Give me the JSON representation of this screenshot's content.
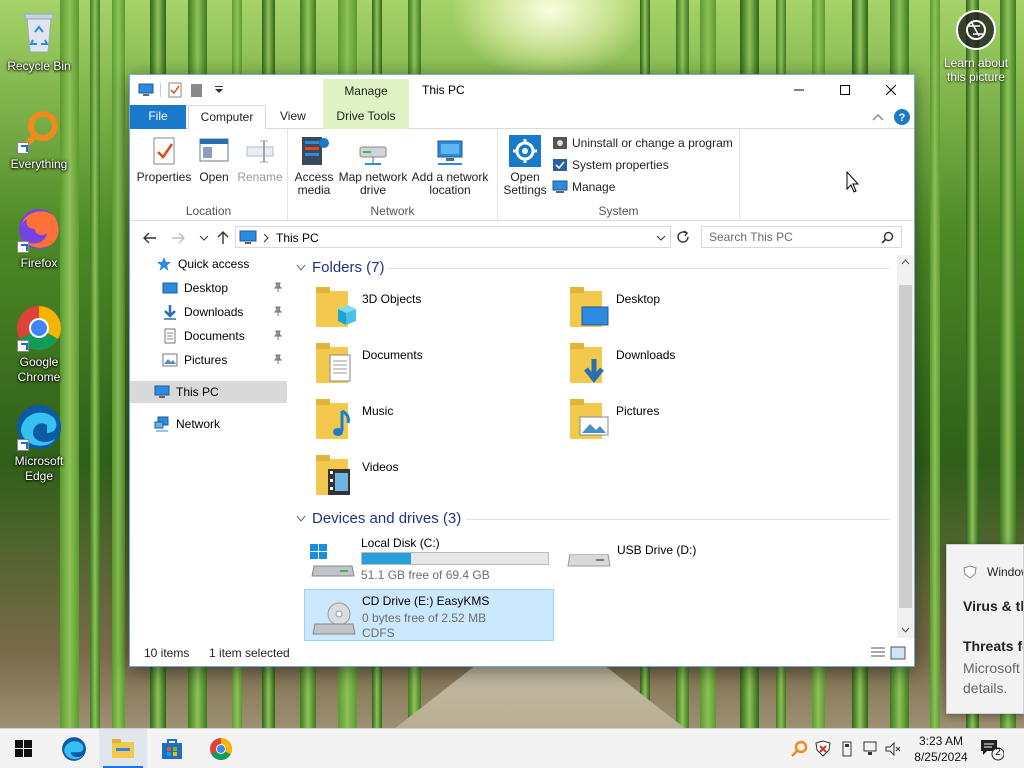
{
  "desktop": {
    "icons": [
      {
        "label": "Recycle Bin"
      },
      {
        "label": "Everything"
      },
      {
        "label": "Firefox"
      },
      {
        "label": "Google Chrome"
      },
      {
        "label": "Microsoft Edge"
      }
    ],
    "learn_label": "Learn about this picture"
  },
  "window": {
    "title": "This PC",
    "contextual_tab": "Manage",
    "tabs": [
      "File",
      "Computer",
      "View",
      "Drive Tools"
    ],
    "ribbon": {
      "location": {
        "label": "Location",
        "buttons": [
          "Properties",
          "Open",
          "Rename"
        ]
      },
      "network": {
        "label": "Network",
        "buttons": [
          "Access media",
          "Map network drive",
          "Add a network location"
        ]
      },
      "system": {
        "label": "System",
        "open_settings": "Open Settings",
        "items": [
          "Uninstall or change a program",
          "System properties",
          "Manage"
        ]
      }
    },
    "address": {
      "path": "This PC",
      "search_placeholder": "Search This PC"
    },
    "nav": {
      "quick_access": "Quick access",
      "pinned": [
        "Desktop",
        "Downloads",
        "Documents",
        "Pictures"
      ],
      "this_pc": "This PC",
      "network": "Network"
    },
    "folders": {
      "header": "Folders (7)",
      "items": [
        "3D Objects",
        "Desktop",
        "Documents",
        "Downloads",
        "Music",
        "Pictures",
        "Videos"
      ]
    },
    "drives": {
      "header": "Devices and drives (3)",
      "items": [
        {
          "name": "Local Disk (C:)",
          "free": "51.1 GB free of 69.4 GB",
          "used_fraction": 0.264
        },
        {
          "name": "USB Drive (D:)"
        },
        {
          "name": "CD Drive (E:) EasyKMS",
          "free": "0 bytes free of 2.52 MB",
          "fs": "CDFS"
        }
      ]
    },
    "status": {
      "count": "10 items",
      "selected": "1 item selected"
    }
  },
  "toast": {
    "app": "Windows",
    "title": "Virus & th",
    "subtitle": "Threats fo",
    "body1": "Microsoft",
    "body2": "details."
  },
  "taskbar": {
    "time": "3:23 AM",
    "date": "8/25/2024",
    "notifications": "2"
  }
}
